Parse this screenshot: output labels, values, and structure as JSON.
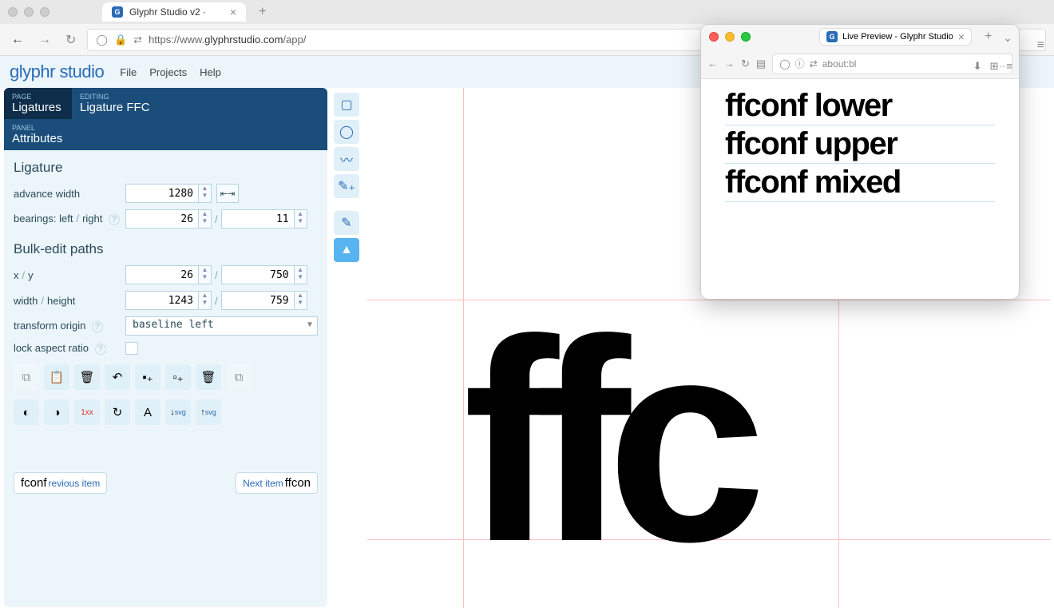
{
  "main_browser": {
    "tab_title": "Glyphr Studio v2 ·",
    "url_prefix": "https://www.",
    "url_domain": "glyphrstudio.com",
    "url_path": "/app/"
  },
  "app": {
    "logo": "glyphr studio",
    "menu": [
      "File",
      "Projects",
      "Help"
    ]
  },
  "panel": {
    "page_label": "PAGE",
    "page_value": "Ligatures",
    "editing_label": "EDITING",
    "editing_value": "Ligature FFC",
    "panel_label": "PANEL",
    "panel_value": "Attributes"
  },
  "ligature": {
    "section": "Ligature",
    "advance_width_label": "advance width",
    "advance_width": "1280",
    "bearings_label_left": "bearings: left",
    "bearings_label_right": "right",
    "bearing_left": "26",
    "bearing_right": "11"
  },
  "bulk": {
    "section": "Bulk-edit paths",
    "xy_x": "x",
    "xy_y": "y",
    "x": "26",
    "y": "750",
    "width_label": "width",
    "height_label": "height",
    "width": "1243",
    "height": "759",
    "transform_label": "transform origin",
    "transform_value": "baseline left",
    "lock_label": "lock aspect ratio"
  },
  "nav": {
    "prev_glyph": "fconf",
    "prev_label": "revious item",
    "next_label": "Next item",
    "next_glyph": "ffcon"
  },
  "canvas": {
    "glyph": "ffc"
  },
  "popup": {
    "tab_title": "Live Preview - Glyphr Studio",
    "url": "about:bl",
    "lines": [
      "ffconf lower",
      "ffconf upper",
      "ffconf mixed"
    ]
  }
}
